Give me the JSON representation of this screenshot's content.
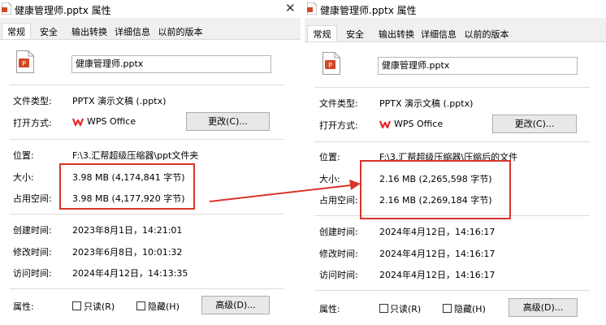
{
  "left": {
    "window_title": "健康管理师.pptx 属性",
    "tabs": [
      "常规",
      "安全",
      "输出转换",
      "详细信息",
      "以前的版本"
    ],
    "file_name": "健康管理师.pptx",
    "labels": {
      "type": "文件类型:",
      "open_with": "打开方式:",
      "location": "位置:",
      "size": "大小:",
      "size_on_disk": "占用空间:",
      "created": "创建时间:",
      "modified": "修改时间:",
      "accessed": "访问时间:",
      "attributes": "属性:"
    },
    "values": {
      "type": "PPTX 演示文稿 (.pptx)",
      "open_with": "WPS Office",
      "location": "F:\\3.汇帮超级压缩器\\ppt文件夹",
      "size": "3.98 MB (4,174,841 字节)",
      "size_on_disk": "3.98 MB (4,177,920 字节)",
      "created": "2023年8月1日，14:21:01",
      "modified": "2023年6月8日，10:01:32",
      "accessed": "2024年4月12日，14:13:35"
    },
    "change_button": "更改(C)...",
    "readonly": "只读(R)",
    "hidden": "隐藏(H)",
    "advanced_button": "高级(D)..."
  },
  "right": {
    "window_title": "健康管理师.pptx 属性",
    "tabs": [
      "常规",
      "安全",
      "输出转换",
      "详细信息",
      "以前的版本"
    ],
    "file_name": "健康管理师.pptx",
    "labels": {
      "type": "文件类型:",
      "open_with": "打开方式:",
      "location": "位置:",
      "size": "大小:",
      "size_on_disk": "占用空间:",
      "created": "创建时间:",
      "modified": "修改时间:",
      "accessed": "访问时间:",
      "attributes": "属性:"
    },
    "values": {
      "type": "PPTX 演示文稿 (.pptx)",
      "open_with": "WPS Office",
      "location": "F:\\3.汇帮超级压缩器\\压缩后的文件",
      "size": "2.16 MB (2,265,598 字节)",
      "size_on_disk": "2.16 MB (2,269,184 字节)",
      "created": "2024年4月12日，14:16:17",
      "modified": "2024年4月12日，14:16:17",
      "accessed": "2024年4月12日，14:16:17"
    },
    "change_button": "更改(C)...",
    "readonly": "只读(R)",
    "hidden": "隐藏(H)",
    "advanced_button": "高级(D)..."
  },
  "icons": {
    "close": "close-icon",
    "pptx": "pptx-file-icon",
    "wps": "wps-office-icon",
    "arrow": "comparison-arrow"
  },
  "colors": {
    "highlight": "#d9352b",
    "pptx_orange": "#d24726",
    "wps_red": "#e8262a"
  }
}
